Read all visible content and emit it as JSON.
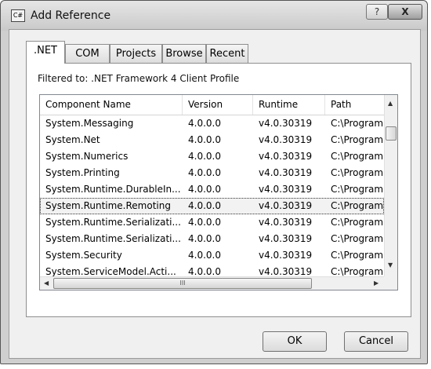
{
  "window": {
    "title": "Add Reference",
    "icon_label": "C#",
    "help_label": "?",
    "close_label": "X"
  },
  "tabs": [
    {
      "label": ".NET",
      "active": true
    },
    {
      "label": "COM",
      "active": false
    },
    {
      "label": "Projects",
      "active": false
    },
    {
      "label": "Browse",
      "active": false
    },
    {
      "label": "Recent",
      "active": false
    }
  ],
  "filter_text": "Filtered to: .NET Framework 4 Client Profile",
  "table": {
    "columns": [
      "Component Name",
      "Version",
      "Runtime",
      "Path"
    ],
    "rows": [
      {
        "name": "System.Messaging",
        "version": "4.0.0.0",
        "runtime": "v4.0.30319",
        "path": "C:\\Program"
      },
      {
        "name": "System.Net",
        "version": "4.0.0.0",
        "runtime": "v4.0.30319",
        "path": "C:\\Program"
      },
      {
        "name": "System.Numerics",
        "version": "4.0.0.0",
        "runtime": "v4.0.30319",
        "path": "C:\\Program"
      },
      {
        "name": "System.Printing",
        "version": "4.0.0.0",
        "runtime": "v4.0.30319",
        "path": "C:\\Program"
      },
      {
        "name": "System.Runtime.DurableIn...",
        "version": "4.0.0.0",
        "runtime": "v4.0.30319",
        "path": "C:\\Program"
      },
      {
        "name": "System.Runtime.Remoting",
        "version": "4.0.0.0",
        "runtime": "v4.0.30319",
        "path": "C:\\Program",
        "selected": true
      },
      {
        "name": "System.Runtime.Serializati...",
        "version": "4.0.0.0",
        "runtime": "v4.0.30319",
        "path": "C:\\Program"
      },
      {
        "name": "System.Runtime.Serializati...",
        "version": "4.0.0.0",
        "runtime": "v4.0.30319",
        "path": "C:\\Program"
      },
      {
        "name": "System.Security",
        "version": "4.0.0.0",
        "runtime": "v4.0.30319",
        "path": "C:\\Program"
      },
      {
        "name": "System.ServiceModel.Acti...",
        "version": "4.0.0.0",
        "runtime": "v4.0.30319",
        "path": "C:\\Program"
      }
    ]
  },
  "scrollbar": {
    "h_thumb_grip": "III"
  },
  "buttons": {
    "ok": "OK",
    "cancel": "Cancel"
  }
}
